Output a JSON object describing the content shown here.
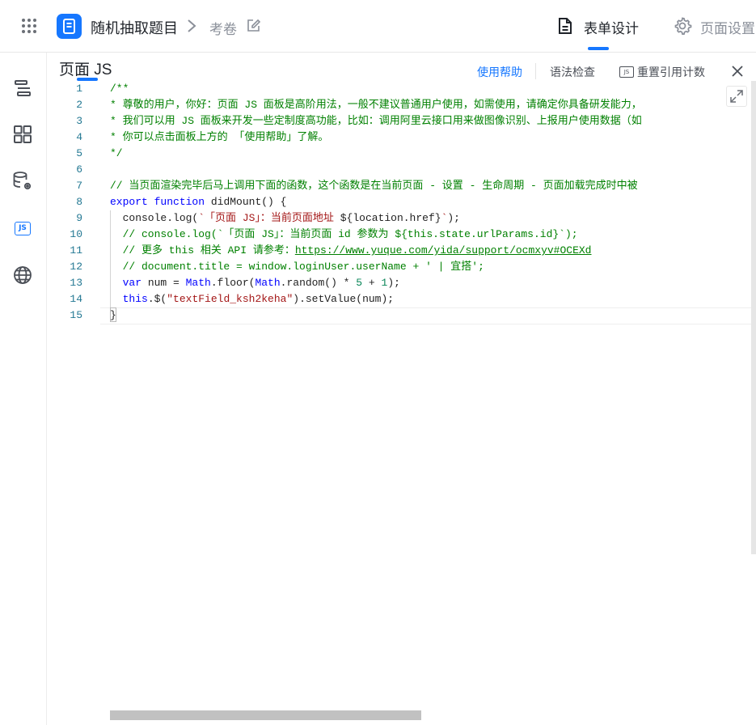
{
  "header": {
    "app_name": "随机抽取题目",
    "breadcrumb": "考卷",
    "tabs": [
      {
        "label": "表单设计",
        "active": true
      },
      {
        "label": "页面设置",
        "active": false
      }
    ]
  },
  "sidebar": {
    "items": [
      {
        "icon": "outline-tree-icon"
      },
      {
        "icon": "components-grid-icon"
      },
      {
        "icon": "datasource-settings-icon"
      },
      {
        "icon": "js-icon",
        "label": "JS",
        "active": true
      },
      {
        "icon": "globe-icon"
      }
    ]
  },
  "panel": {
    "title": "页面 JS",
    "help": "使用帮助",
    "syntax_check": "语法检查",
    "reset_badge": "JS",
    "reset_counts": "重置引用计数"
  },
  "editor": {
    "lines": [
      {
        "n": "1",
        "tokens": [
          {
            "t": "/**",
            "c": "comment"
          }
        ]
      },
      {
        "n": "2",
        "tokens": [
          {
            "t": "* 尊敬的用户，你好：页面 JS 面板是高阶用法，一般不建议普通用户使用，如需使用，请确定你具备研发能力，",
            "c": "comment"
          }
        ]
      },
      {
        "n": "3",
        "tokens": [
          {
            "t": "* 我们可以用 JS 面板来开发一些定制度高功能，比如：调用阿里云接口用来做图像识别、上报用户使用数据（如",
            "c": "comment"
          }
        ]
      },
      {
        "n": "4",
        "tokens": [
          {
            "t": "* 你可以点击面板上方的 「使用帮助」了解。",
            "c": "comment"
          }
        ]
      },
      {
        "n": "5",
        "tokens": [
          {
            "t": "*/",
            "c": "comment"
          }
        ]
      },
      {
        "n": "6",
        "tokens": []
      },
      {
        "n": "7",
        "tokens": [
          {
            "t": "// 当页面渲染完毕后马上调用下面的函数，这个函数是在当前页面 - 设置 - 生命周期 - 页面加载完成时中被",
            "c": "comment"
          }
        ]
      },
      {
        "n": "8",
        "tokens": [
          {
            "t": "export",
            "c": "kw"
          },
          {
            "t": " ",
            "c": "plain"
          },
          {
            "t": "function",
            "c": "kw"
          },
          {
            "t": " didMount() {",
            "c": "plain"
          }
        ]
      },
      {
        "n": "9",
        "tokens": [
          {
            "t": "  console.log(",
            "c": "plain"
          },
          {
            "t": "`「页面 JS」：当前页面地址 ",
            "c": "str"
          },
          {
            "t": "${location.href}",
            "c": "plain"
          },
          {
            "t": "`",
            "c": "str"
          },
          {
            "t": ");",
            "c": "plain"
          }
        ]
      },
      {
        "n": "10",
        "tokens": [
          {
            "t": "  // console.log(`「页面 JS」：当前页面 id 参数为 ${this.state.urlParams.id}`);",
            "c": "comment"
          }
        ]
      },
      {
        "n": "11",
        "tokens": [
          {
            "t": "  // 更多 this 相关 API 请参考：",
            "c": "comment"
          },
          {
            "t": "https://www.yuque.com/yida/support/ocmxyv#OCEXd",
            "c": "url"
          }
        ]
      },
      {
        "n": "12",
        "tokens": [
          {
            "t": "  // document.title = window.loginUser.userName + ' | 宜搭';",
            "c": "comment"
          }
        ]
      },
      {
        "n": "13",
        "tokens": [
          {
            "t": "  ",
            "c": "plain"
          },
          {
            "t": "var",
            "c": "kw"
          },
          {
            "t": " num = ",
            "c": "plain"
          },
          {
            "t": "Math",
            "c": "kw"
          },
          {
            "t": ".floor(",
            "c": "plain"
          },
          {
            "t": "Math",
            "c": "kw"
          },
          {
            "t": ".random() * ",
            "c": "plain"
          },
          {
            "t": "5",
            "c": "num"
          },
          {
            "t": " + ",
            "c": "plain"
          },
          {
            "t": "1",
            "c": "num"
          },
          {
            "t": ");",
            "c": "plain"
          }
        ]
      },
      {
        "n": "14",
        "tokens": [
          {
            "t": "  ",
            "c": "plain"
          },
          {
            "t": "this",
            "c": "kw"
          },
          {
            "t": ".$(",
            "c": "plain"
          },
          {
            "t": "\"textField_ksh2keha\"",
            "c": "str"
          },
          {
            "t": ").setValue(num);",
            "c": "plain"
          }
        ]
      },
      {
        "n": "15",
        "tokens": [
          {
            "t": "}",
            "c": "plain"
          }
        ]
      }
    ]
  },
  "colors": {
    "accent": "#1677ff",
    "comment": "#008000",
    "keyword": "#0000ff",
    "string": "#a31515",
    "number": "#098658",
    "line_number": "#237893"
  }
}
